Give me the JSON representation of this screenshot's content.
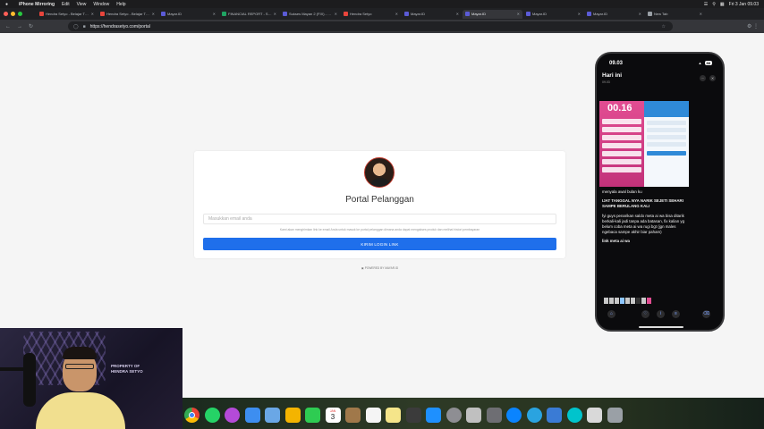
{
  "menubar": {
    "app_name": "iPhone Mirroring",
    "menus": [
      "Edit",
      "View",
      "Window",
      "Help"
    ],
    "clock": "Fri 3 Jan 09.03"
  },
  "browser": {
    "tabs": [
      {
        "label": "Hendra Setyo - Belajar Tiktok",
        "favicon": "#e8453c"
      },
      {
        "label": "Hendra Setyo - Belajar Tiktok",
        "favicon": "#e8453c"
      },
      {
        "label": "Mayar.ID",
        "favicon": "#5b5bd6"
      },
      {
        "label": "FINANCIAL REPORT - Sang...",
        "favicon": "#1fa463"
      },
      {
        "label": "Sukses Mayan 2 (FIX) - server",
        "favicon": "#5b5bd6"
      },
      {
        "label": "Hendra Setyo",
        "favicon": "#e8453c"
      },
      {
        "label": "Mayar.ID",
        "favicon": "#5b5bd6"
      },
      {
        "label": "Mayar.ID",
        "favicon": "#5b5bd6"
      },
      {
        "label": "Mayar.ID",
        "favicon": "#5b5bd6"
      },
      {
        "label": "Mayar.ID",
        "favicon": "#5b5bd6"
      },
      {
        "label": "New Tab",
        "favicon": "#9aa0a6"
      }
    ],
    "active_tab_index": 7,
    "url": "https://hendrasetyo.com/portal"
  },
  "portal": {
    "title": "Portal Pelanggan",
    "email_placeholder": "Masukkan email anda",
    "help_text": "Kami akan mengirimkan link ke email Anda untuk masuk ke portal pelanggan dimana anda dapat mengakses produk dan melihat histori pembayaran",
    "submit_label": "KIRIM LOGIN LINK",
    "powered_by": "POWERED BY MAYAR.ID",
    "accent_color": "#1f6feb"
  },
  "phone": {
    "time": "09.03",
    "battery": "88",
    "chat_title": "Hari ini",
    "chat_time": "09.03",
    "story_clock": "00.16",
    "caption": {
      "line1": "menyala awal bulan ku",
      "line2": "IJAT TANGGAL NYA NARIK SEJETI SEHARI SAMPE BERULANG KALI",
      "line3": "fyi guys penarikan saldo meta ai wa bisa ditarik berkali-kali jadi tanpa ada batasan, fix kalian yg belum coba meta ai wa rugi bgt (jgn males ngebaca sampe akhir biar paham)",
      "line4": "link meta ai wa"
    }
  },
  "webcam": {
    "watermark_line1": "PROPERTY OF",
    "watermark_line2": "HENDRA SETYO"
  },
  "dock": {
    "calendar_month": "JAN",
    "calendar_day": "3",
    "apps": [
      {
        "name": "chrome-icon",
        "color": "#ffffff"
      },
      {
        "name": "whatsapp-icon",
        "color": "#25d366"
      },
      {
        "name": "flower-icon",
        "color": "#b44ad8"
      },
      {
        "name": "mail-icon",
        "color": "#3d8ef0"
      },
      {
        "name": "preview-icon",
        "color": "#6aa7e6"
      },
      {
        "name": "photos-icon",
        "color": "#f4b400"
      },
      {
        "name": "facetime-icon",
        "color": "#2ecc52"
      },
      {
        "name": "calendar-icon",
        "color": "#ffffff"
      },
      {
        "name": "box-icon",
        "color": "#a0784a"
      },
      {
        "name": "reminders-icon",
        "color": "#f5f5f5"
      },
      {
        "name": "notes-icon",
        "color": "#f5e58a"
      },
      {
        "name": "calculator-icon",
        "color": "#3b3b3b"
      },
      {
        "name": "app-store-icon",
        "color": "#1e90ff"
      },
      {
        "name": "settings-icon",
        "color": "#8e8e93"
      },
      {
        "name": "scissors-icon",
        "color": "#c0c0c0"
      },
      {
        "name": "gear-icon",
        "color": "#6e6e73"
      },
      {
        "name": "search-icon",
        "color": "#0a84ff"
      },
      {
        "name": "telegram-icon",
        "color": "#2aa3e0"
      },
      {
        "name": "s-app-icon",
        "color": "#3a7bd5"
      },
      {
        "name": "canva-icon",
        "color": "#00c4cc"
      },
      {
        "name": "document-icon",
        "color": "#d9d9d9"
      },
      {
        "name": "trash-icon",
        "color": "#9aa0a6"
      }
    ]
  }
}
